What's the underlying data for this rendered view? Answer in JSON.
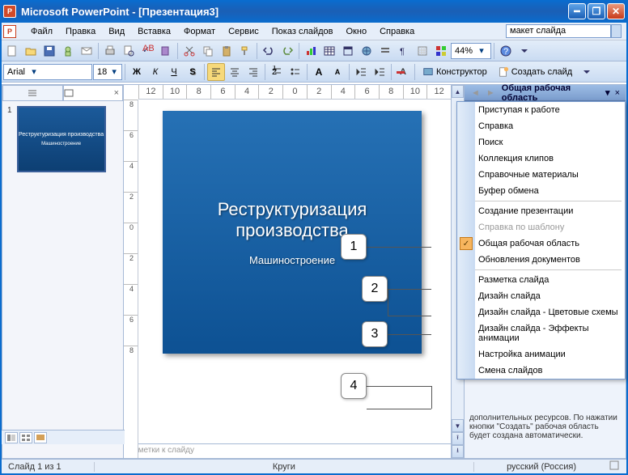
{
  "window": {
    "title": "Microsoft PowerPoint - [Презентация3]"
  },
  "menu": {
    "items": [
      "Файл",
      "Правка",
      "Вид",
      "Вставка",
      "Формат",
      "Сервис",
      "Показ слайдов",
      "Окно",
      "Справка"
    ],
    "askbox": "макет слайда"
  },
  "toolbar2": {
    "font": "Arial",
    "size": "18",
    "zoom": "44%",
    "designer": "Конструктор",
    "newslide": "Создать слайд"
  },
  "hruler": [
    "12",
    "10",
    "8",
    "6",
    "4",
    "2",
    "0",
    "2",
    "4",
    "6",
    "8",
    "10",
    "12"
  ],
  "vruler": [
    "8",
    "6",
    "4",
    "2",
    "0",
    "2",
    "4",
    "6",
    "8"
  ],
  "thumb": {
    "num": "1",
    "title": "Реструктуризация производства",
    "sub": "Машиностроение"
  },
  "slide": {
    "title_l1": "Реструктуризация",
    "title_l2": "производства",
    "sub": "Машиностроение"
  },
  "callouts": [
    "1",
    "2",
    "3",
    "4"
  ],
  "taskpane": {
    "title": "Общая рабочая область",
    "menu": [
      {
        "label": "Приступая к работе"
      },
      {
        "label": "Справка"
      },
      {
        "label": "Поиск"
      },
      {
        "label": "Коллекция клипов"
      },
      {
        "label": "Справочные материалы"
      },
      {
        "label": "Буфер обмена"
      },
      {
        "sep": true
      },
      {
        "label": "Создание презентации"
      },
      {
        "label": "Справка по шаблону",
        "disabled": true
      },
      {
        "label": "Общая рабочая область",
        "checked": true
      },
      {
        "label": "Обновления документов"
      },
      {
        "sep": true
      },
      {
        "label": "Разметка слайда"
      },
      {
        "label": "Дизайн слайда"
      },
      {
        "label": "Дизайн слайда - Цветовые схемы"
      },
      {
        "label": "Дизайн слайда - Эффекты анимации"
      },
      {
        "label": "Настройка анимации"
      },
      {
        "label": "Смена слайдов"
      }
    ],
    "bodytext": "дополнительных ресурсов. По нажатии кнопки \"Создать\" рабочая область будет создана автоматически."
  },
  "notes": "Заметки к слайду",
  "status": {
    "slide": "Слайд 1 из 1",
    "theme": "Круги",
    "lang": "русский (Россия)"
  }
}
